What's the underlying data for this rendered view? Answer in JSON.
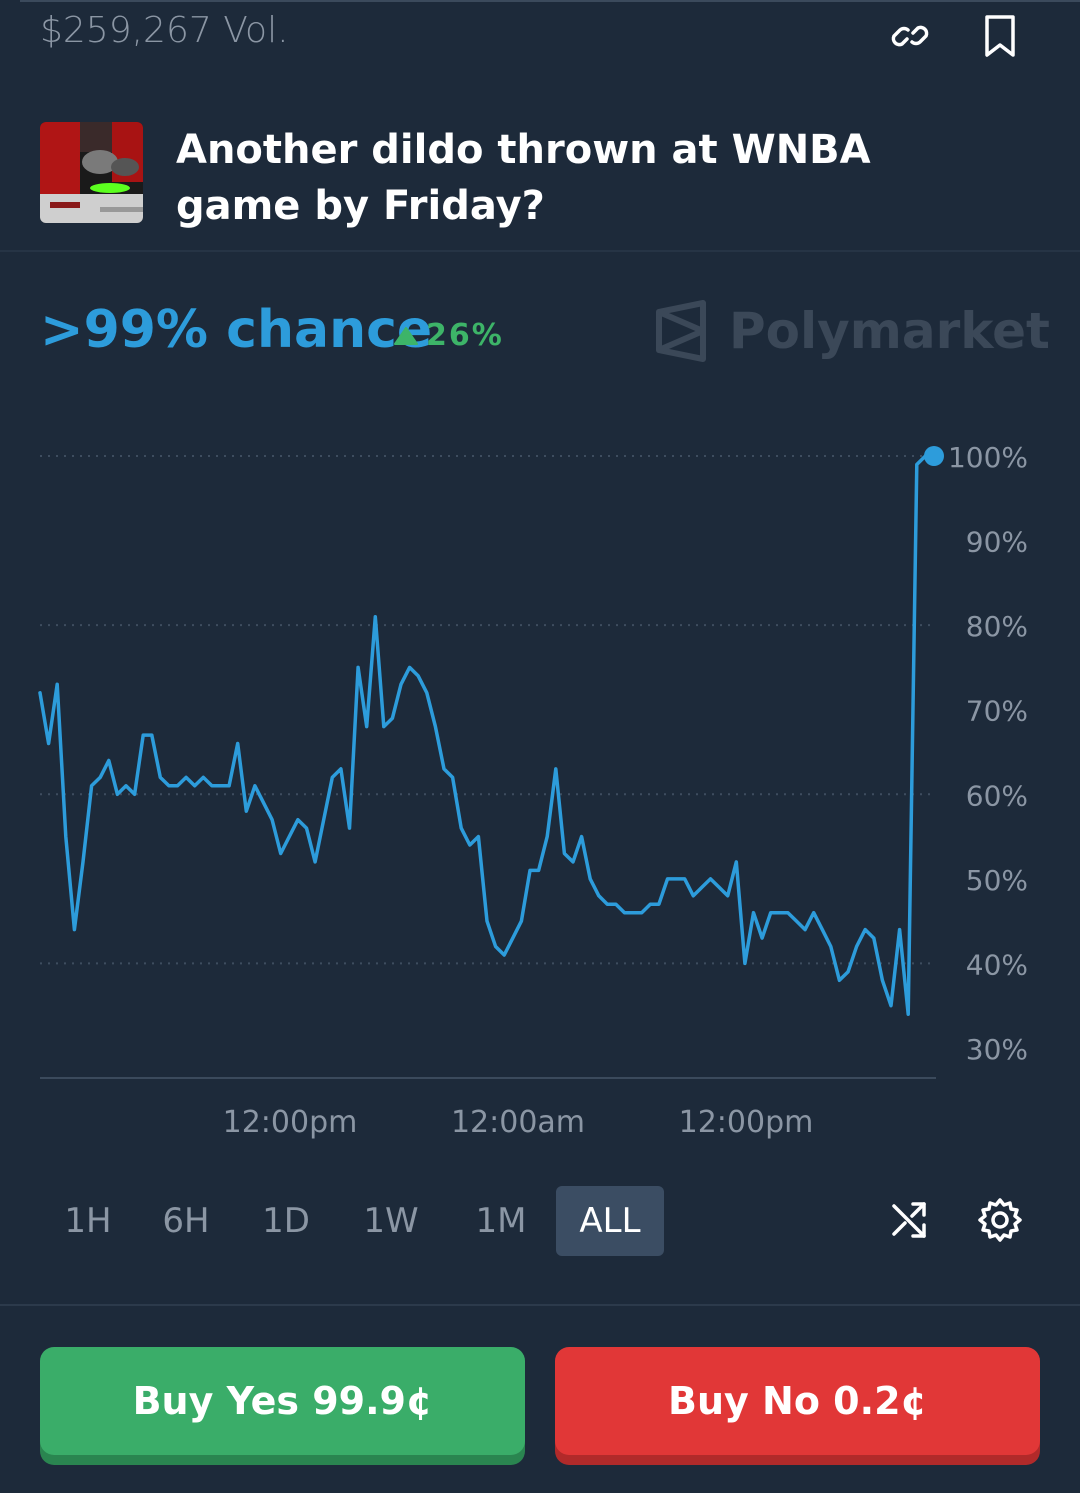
{
  "market": {
    "volume": "$259,267 Vol.",
    "title": "Another dildo thrown at WNBA game by Friday?",
    "chance": ">99% chance",
    "change": "26%",
    "brand": "Polymarket"
  },
  "icons": {
    "link": "link-icon",
    "bookmark": "bookmark-icon",
    "change_up": "triangle-up-icon",
    "brand_logo": "polymarket-logo-icon",
    "shuffle": "shuffle-icon",
    "settings": "gear-icon"
  },
  "colors": {
    "background": "#1d2a3a",
    "accent": "#2d9cdb",
    "positive": "#3db468",
    "yes_button": "#3aad69",
    "no_button": "#e13737"
  },
  "time_ranges": [
    {
      "label": "1H",
      "active": false
    },
    {
      "label": "6H",
      "active": false
    },
    {
      "label": "1D",
      "active": false
    },
    {
      "label": "1W",
      "active": false
    },
    {
      "label": "1M",
      "active": false
    },
    {
      "label": "ALL",
      "active": true
    }
  ],
  "actions": {
    "buy_yes": "Buy Yes 99.9¢",
    "buy_no": "Buy No 0.2¢"
  },
  "chart_data": {
    "type": "line",
    "y_ticks": [
      "100%",
      "90%",
      "80%",
      "70%",
      "60%",
      "50%",
      "40%",
      "30%"
    ],
    "x_ticks": [
      "12:00pm",
      "12:00am",
      "12:00pm"
    ],
    "ylim": [
      30,
      100
    ],
    "grid": true,
    "series": [
      {
        "values": [
          72,
          66,
          73,
          55,
          44,
          52,
          61,
          62,
          64,
          60,
          61,
          60,
          67,
          67,
          62,
          61,
          61,
          62,
          61,
          62,
          61,
          61,
          61,
          66,
          58,
          61,
          59,
          57,
          53,
          55,
          57,
          56,
          52,
          57,
          62,
          63,
          56,
          75,
          68,
          81,
          68,
          69,
          73,
          75,
          74,
          72,
          68,
          63,
          62,
          56,
          54,
          55,
          45,
          42,
          41,
          43,
          45,
          51,
          51,
          55,
          63,
          53,
          52,
          55,
          50,
          48,
          47,
          47,
          46,
          46,
          46,
          47,
          47,
          50,
          50,
          50,
          48,
          49,
          50,
          49,
          48,
          52,
          40,
          46,
          43,
          46,
          46,
          46,
          45,
          44,
          46,
          44,
          42,
          38,
          39,
          42,
          44,
          43,
          38,
          35,
          44,
          34,
          99,
          100,
          100
        ]
      }
    ]
  }
}
